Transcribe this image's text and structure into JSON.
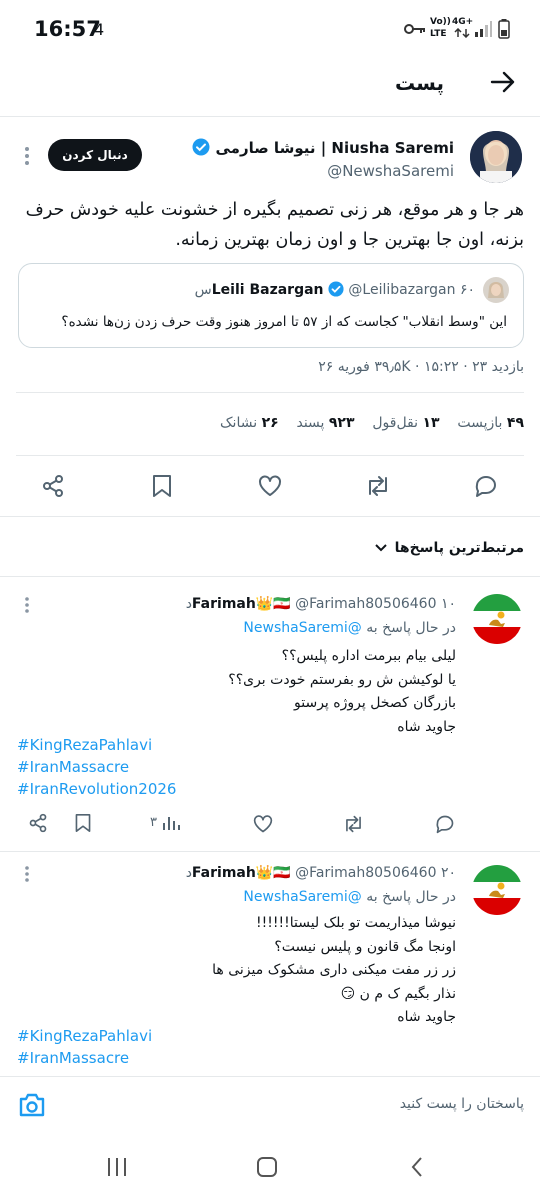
{
  "status_bar": {
    "time": "16:57",
    "notif_count": "4",
    "net_vo": "Vo))",
    "net_lte": "LTE",
    "net_4g": "4G+",
    "battery": "battery-icon"
  },
  "header": {
    "title": "پست",
    "back_icon": "arrow-right-icon"
  },
  "post": {
    "author_name": "Niusha Saremi | نیوشا صارمی",
    "author_handle": "@NewshaSaremi",
    "follow_label": "دنبال کردن",
    "text": "هر جا و هر موقع، هر زنی تصمیم بگیره از خشونت علیه خودش حرف بزنه، اون جا بهترین جا و اون زمان بهترین زمانه.",
    "quote": {
      "author_name": "Leili Bazargan",
      "author_handle": "@Leilibazargan",
      "time": "۶۰س",
      "text": "این \"وسط انقلاب\" کجاست که از ۵۷ تا امروز هنوز وقت حرف زدن زن‌ها نشده؟"
    },
    "meta_line": "بازدید ۳۹٫۵K · ۱۵:۲۲ · ۲۳ فوریه ۲۶",
    "stats": {
      "reposts_num": "۴۹",
      "reposts_label": "بازپست",
      "quotes_num": "۱۳",
      "quotes_label": "نقل‌قول",
      "likes_num": "۹۲۳",
      "likes_label": "پسند",
      "bookmarks_num": "۲۶",
      "bookmarks_label": "نشانک"
    }
  },
  "replies_filter": "مرتبط‌ترین پاسخ‌ها",
  "replies": [
    {
      "author_name": "Farimah",
      "author_emoji": "👑🇮🇷",
      "author_handle": "@Farimah80506460",
      "time": "۱۰د",
      "replying_to_label": "در حال پاسخ به",
      "replying_to_handle": "@NewshaSaremi",
      "lines": [
        "لیلی بیام ببرمت اداره پلیس؟؟",
        "یا لوکیشن ش رو بفرستم خودت بری؟؟",
        "بازرگان کصخل پروژه پرستو",
        "جاوید شاه"
      ],
      "hashtags": [
        "#KingRezaPahlavi",
        "#IranMassacre",
        "#IranRevolution2026"
      ],
      "views": "۳"
    },
    {
      "author_name": "Farimah",
      "author_emoji": "👑🇮🇷",
      "author_handle": "@Farimah80506460",
      "time": "۲۰د",
      "replying_to_label": "در حال پاسخ به",
      "replying_to_handle": "@NewshaSaremi",
      "lines": [
        "نیوشا میذاریمت تو بلک لیستا!!!!!!",
        "اونجا مگ قانون و پلیس نیست؟",
        "زر زر مفت میکنی داری مشکوک میزنی ها",
        "نذار بگیم ک م ن 😏",
        "جاوید شاه"
      ],
      "hashtags": [
        "#KingRezaPahlavi",
        "#IranMassacre"
      ]
    }
  ],
  "compose": {
    "placeholder": "پاسختان را پست کنید"
  }
}
